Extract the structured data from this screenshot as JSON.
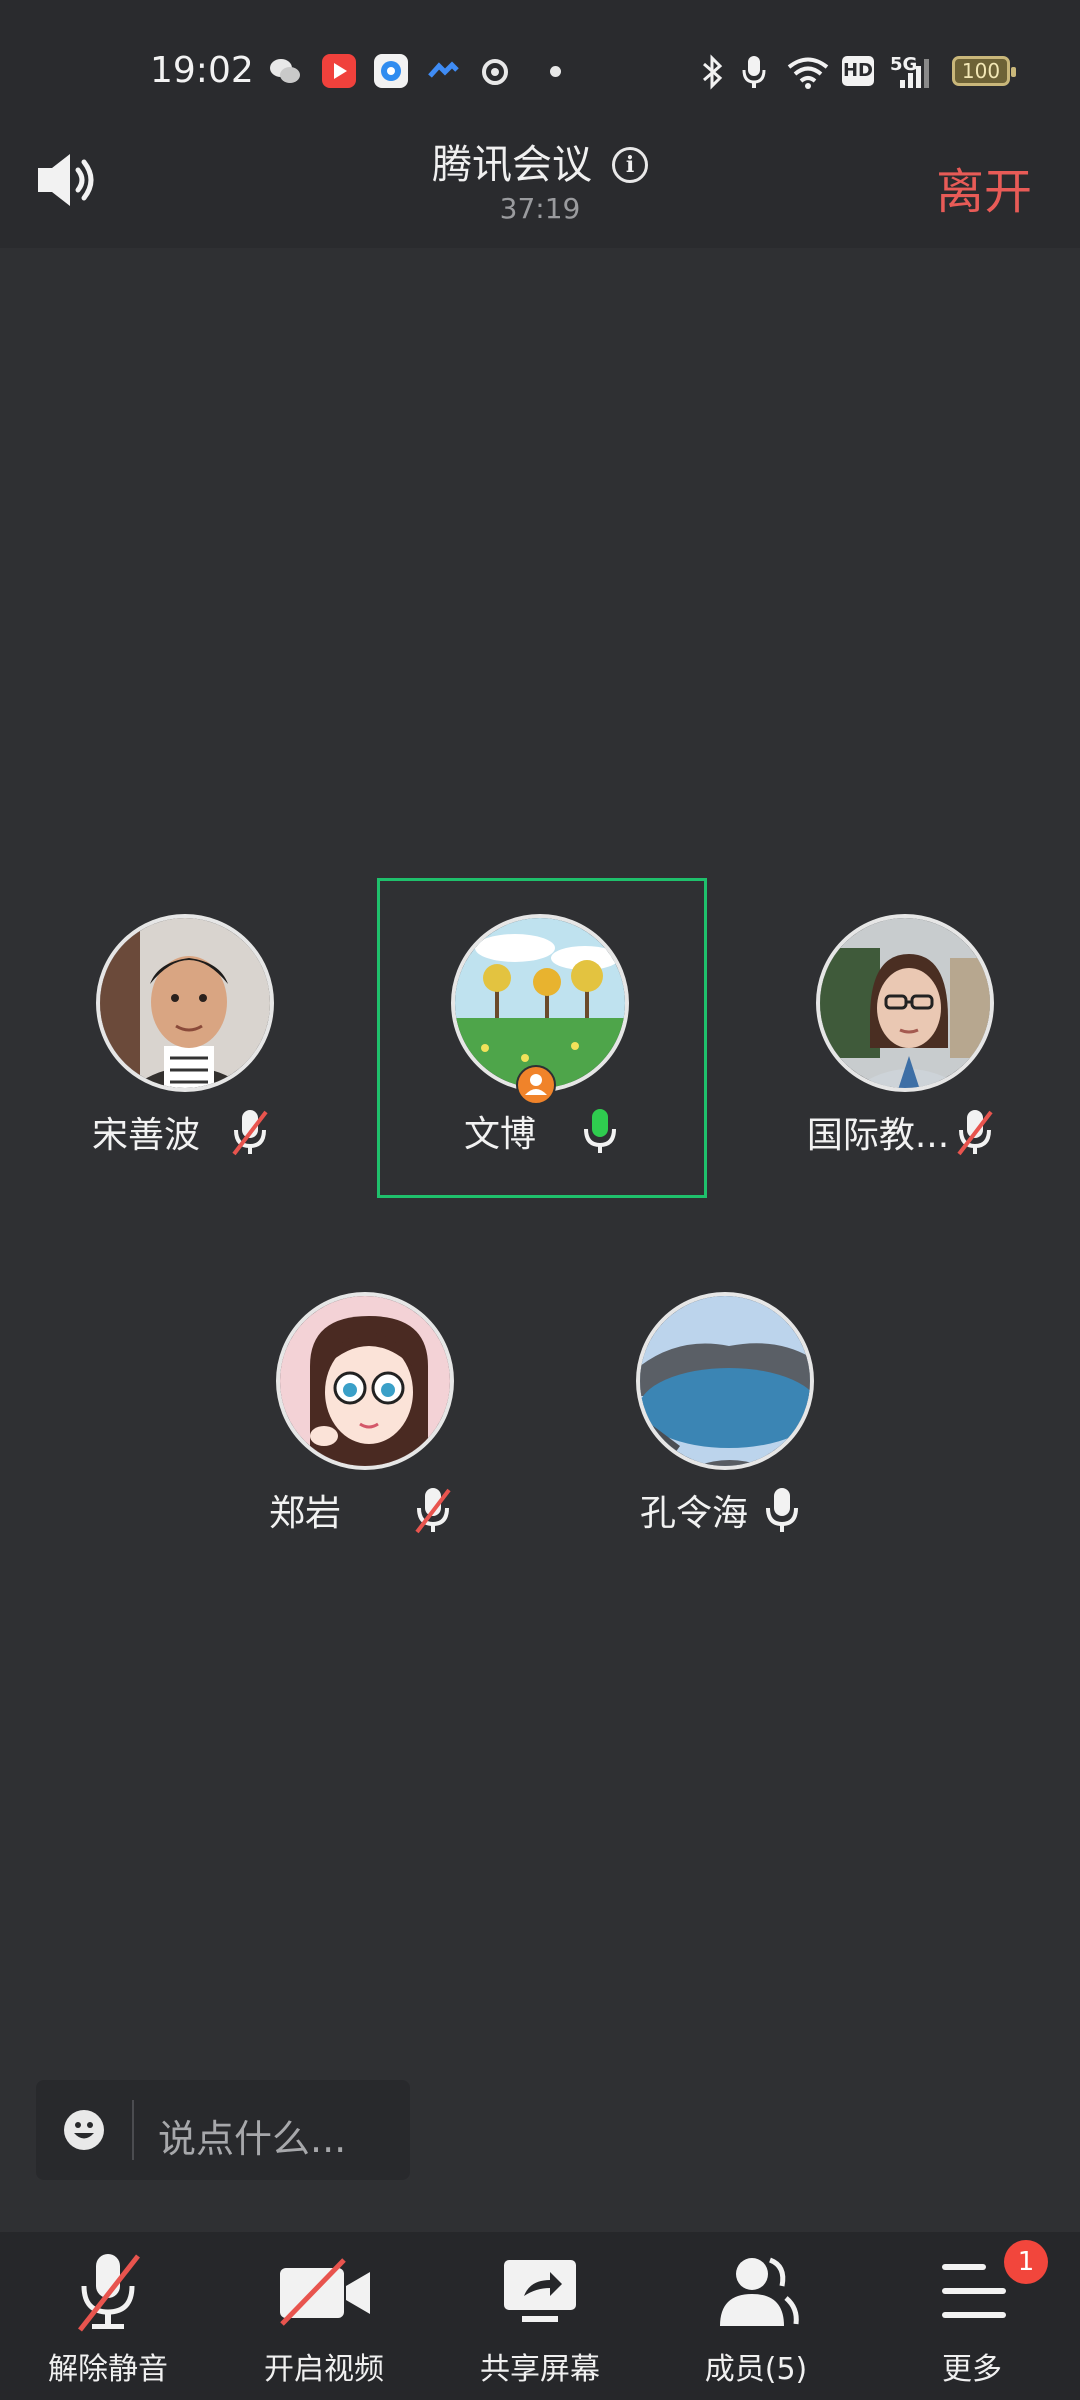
{
  "status_bar": {
    "time": "19:02",
    "network": "5G",
    "hd": "HD",
    "battery": "100"
  },
  "header": {
    "title": "腾讯会议",
    "duration": "37:19",
    "leave_label": "离开"
  },
  "participants": [
    {
      "name": "宋善波",
      "mic": "muted"
    },
    {
      "name": "文博",
      "mic": "speaking",
      "host": true,
      "active": true
    },
    {
      "name": "国际教...",
      "mic": "muted"
    },
    {
      "name": "郑岩",
      "mic": "muted"
    },
    {
      "name": "孔令海",
      "mic": "on"
    }
  ],
  "chat": {
    "placeholder": "说点什么..."
  },
  "toolbar": {
    "unmute_label": "解除静音",
    "video_label": "开启视频",
    "share_label": "共享屏幕",
    "members_label": "成员(5)",
    "more_label": "更多",
    "more_badge": "1"
  },
  "colors": {
    "accent_green": "#1fc06c",
    "leave_red": "#e85b57",
    "badge_red": "#f2463c",
    "host_orange": "#f0832a"
  }
}
